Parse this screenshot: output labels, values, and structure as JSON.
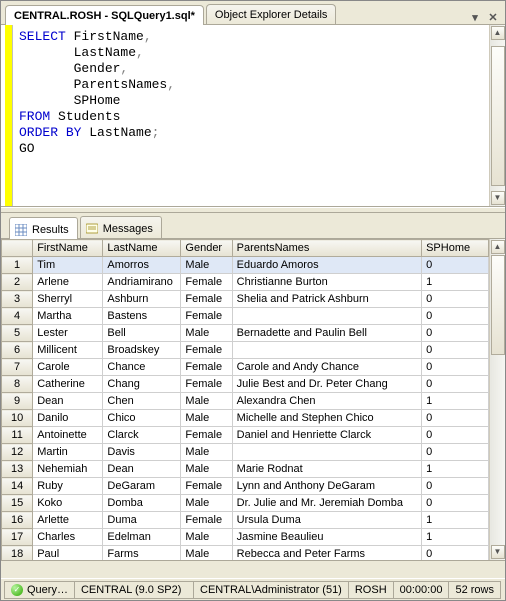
{
  "tabs": {
    "active": "CENTRAL.ROSH - SQLQuery1.sql*",
    "inactive": "Object Explorer Details"
  },
  "sql": {
    "tokens": [
      [
        "kw",
        "SELECT"
      ],
      [
        "p",
        " FirstName"
      ],
      [
        "semi",
        ","
      ],
      [
        "nl",
        ""
      ],
      [
        "pad",
        "       "
      ],
      [
        "p",
        "LastName"
      ],
      [
        "semi",
        ","
      ],
      [
        "nl",
        ""
      ],
      [
        "pad",
        "       "
      ],
      [
        "p",
        "Gender"
      ],
      [
        "semi",
        ","
      ],
      [
        "nl",
        ""
      ],
      [
        "pad",
        "       "
      ],
      [
        "p",
        "ParentsNames"
      ],
      [
        "semi",
        ","
      ],
      [
        "nl",
        ""
      ],
      [
        "pad",
        "       "
      ],
      [
        "p",
        "SPHome"
      ],
      [
        "nl",
        ""
      ],
      [
        "kw",
        "FROM"
      ],
      [
        "p",
        " Students"
      ],
      [
        "nl",
        ""
      ],
      [
        "kw",
        "ORDER"
      ],
      [
        "p",
        " "
      ],
      [
        "kw",
        "BY"
      ],
      [
        "p",
        " LastName"
      ],
      [
        "semi",
        ";"
      ],
      [
        "nl",
        ""
      ],
      [
        "p",
        "GO"
      ]
    ]
  },
  "results_tabs": {
    "results": "Results",
    "messages": "Messages"
  },
  "columns": [
    "FirstName",
    "LastName",
    "Gender",
    "ParentsNames",
    "SPHome"
  ],
  "col_classes": [
    "fn",
    "ln",
    "gd",
    "pn",
    "sp"
  ],
  "rows": [
    {
      "n": 1,
      "FirstName": "Tim",
      "LastName": "Amorros",
      "Gender": "Male",
      "ParentsNames": "Eduardo Amoros",
      "SPHome": "0"
    },
    {
      "n": 2,
      "FirstName": "Arlene",
      "LastName": "Andriamirano",
      "Gender": "Female",
      "ParentsNames": "Christianne Burton",
      "SPHome": "1"
    },
    {
      "n": 3,
      "FirstName": "Sherryl",
      "LastName": "Ashburn",
      "Gender": "Female",
      "ParentsNames": "Shelia and Patrick Ashburn",
      "SPHome": "0"
    },
    {
      "n": 4,
      "FirstName": "Martha",
      "LastName": "Bastens",
      "Gender": "Female",
      "ParentsNames": "",
      "SPHome": "0"
    },
    {
      "n": 5,
      "FirstName": "Lester",
      "LastName": "Bell",
      "Gender": "Male",
      "ParentsNames": "Bernadette and Paulin Bell",
      "SPHome": "0"
    },
    {
      "n": 6,
      "FirstName": "Millicent",
      "LastName": "Broadskey",
      "Gender": "Female",
      "ParentsNames": "",
      "SPHome": "0"
    },
    {
      "n": 7,
      "FirstName": "Carole",
      "LastName": "Chance",
      "Gender": "Female",
      "ParentsNames": "Carole and Andy Chance",
      "SPHome": "0"
    },
    {
      "n": 8,
      "FirstName": "Catherine",
      "LastName": "Chang",
      "Gender": "Female",
      "ParentsNames": "Julie Best and Dr. Peter Chang",
      "SPHome": "0"
    },
    {
      "n": 9,
      "FirstName": "Dean",
      "LastName": "Chen",
      "Gender": "Male",
      "ParentsNames": "Alexandra Chen",
      "SPHome": "1"
    },
    {
      "n": 10,
      "FirstName": "Danilo",
      "LastName": "Chico",
      "Gender": "Male",
      "ParentsNames": "Michelle and Stephen Chico",
      "SPHome": "0"
    },
    {
      "n": 11,
      "FirstName": "Antoinette",
      "LastName": "Clarck",
      "Gender": "Female",
      "ParentsNames": "Daniel and Henriette Clarck",
      "SPHome": "0"
    },
    {
      "n": 12,
      "FirstName": "Martin",
      "LastName": "Davis",
      "Gender": "Male",
      "ParentsNames": "",
      "SPHome": "0"
    },
    {
      "n": 13,
      "FirstName": "Nehemiah",
      "LastName": "Dean",
      "Gender": "Male",
      "ParentsNames": "Marie Rodnat",
      "SPHome": "1"
    },
    {
      "n": 14,
      "FirstName": "Ruby",
      "LastName": "DeGaram",
      "Gender": "Female",
      "ParentsNames": "Lynn and Anthony DeGaram",
      "SPHome": "0"
    },
    {
      "n": 15,
      "FirstName": "Koko",
      "LastName": "Domba",
      "Gender": "Male",
      "ParentsNames": "Dr. Julie and Mr. Jeremiah Domba",
      "SPHome": "0"
    },
    {
      "n": 16,
      "FirstName": "Arlette",
      "LastName": "Duma",
      "Gender": "Female",
      "ParentsNames": "Ursula Duma",
      "SPHome": "1"
    },
    {
      "n": 17,
      "FirstName": "Charles",
      "LastName": "Edelman",
      "Gender": "Male",
      "ParentsNames": "Jasmine Beaulieu",
      "SPHome": "1"
    },
    {
      "n": 18,
      "FirstName": "Paul",
      "LastName": "Farms",
      "Gender": "Male",
      "ParentsNames": "Rebecca and Peter Farms",
      "SPHome": "0"
    }
  ],
  "status": {
    "query": "Query…",
    "server": "CENTRAL (9.0 SP2)",
    "login": "CENTRAL\\Administrator (51)",
    "db": "ROSH",
    "elapsed": "00:00:00",
    "rows": "52 rows"
  }
}
